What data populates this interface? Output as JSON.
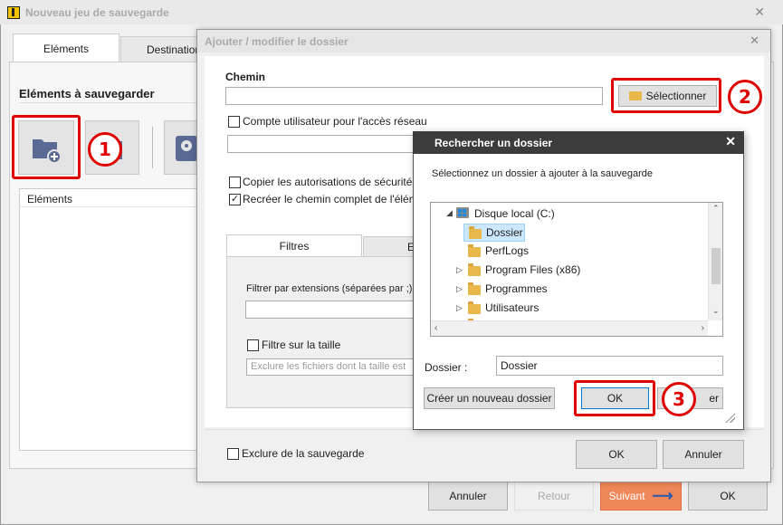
{
  "main_window": {
    "title": "Nouveau jeu de sauvegarde",
    "tabs": [
      "Eléments",
      "Destination"
    ],
    "section_title": "Eléments à sauvegarder",
    "list_header": "Eléments",
    "buttons": {
      "cancel": "Annuler",
      "back": "Retour",
      "next": "Suivant",
      "ok": "OK"
    }
  },
  "add_dialog": {
    "title": "Ajouter / modifier le dossier",
    "path_label": "Chemin",
    "path_value": "",
    "select_button": "Sélectionner",
    "network_account_label": "Compte utilisateur pour l'accès réseau",
    "copy_security_label": "Copier les autorisations de sécurité (un",
    "recreate_path_label": "Recréer le chemin complet de l'élément",
    "tabs": [
      "Filtres",
      "E"
    ],
    "filter_ext_label": "Filtrer par extensions (séparées par ;)",
    "size_filter_label": "Filtre sur la taille",
    "size_placeholder": "Exclure les fichiers dont la taille est",
    "exclude_label": "Exclure de la sauvegarde",
    "ok": "OK",
    "cancel": "Annuler"
  },
  "browse_dialog": {
    "title": "Rechercher un dossier",
    "instruction": "Sélectionnez un dossier à ajouter à la sauvegarde",
    "tree": [
      {
        "label": "Disque local (C:)",
        "level": 0,
        "expanded": true,
        "type": "drive"
      },
      {
        "label": "Dossier",
        "level": 1,
        "selected": true,
        "type": "folder"
      },
      {
        "label": "PerfLogs",
        "level": 1,
        "type": "folder"
      },
      {
        "label": "Program Files (x86)",
        "level": 1,
        "collapsed": true,
        "type": "folder"
      },
      {
        "label": "Programmes",
        "level": 1,
        "collapsed": true,
        "type": "folder"
      },
      {
        "label": "Utilisateurs",
        "level": 1,
        "collapsed": true,
        "type": "folder"
      }
    ],
    "folder_label": "Dossier :",
    "folder_value": "Dossier",
    "new_folder_button": "Créer un nouveau dossier",
    "ok": "OK",
    "cancel_partial": "er"
  },
  "annotations": [
    "1",
    "2",
    "3"
  ],
  "colors": {
    "accent_red": "#e00000",
    "next_button": "#f0875a",
    "folder_yellow": "#e8b84a"
  }
}
